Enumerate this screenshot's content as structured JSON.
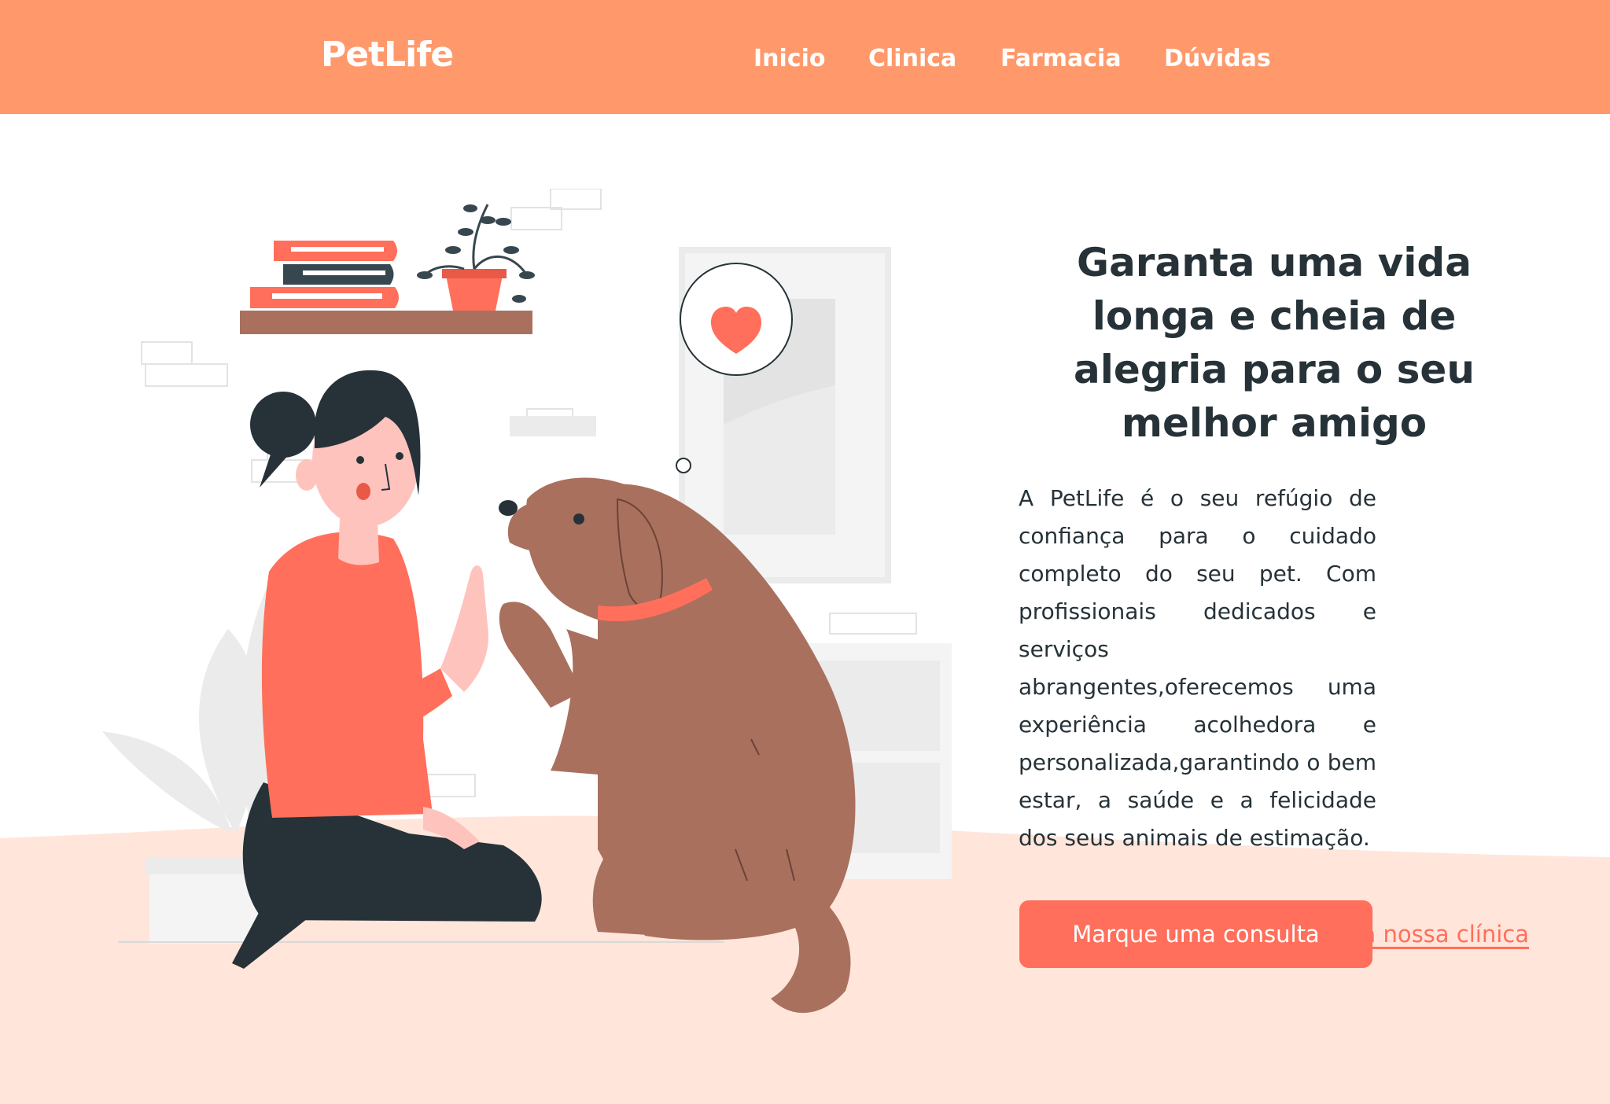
{
  "header": {
    "logo": "PetLife",
    "nav": [
      {
        "label": "Inicio"
      },
      {
        "label": "Clinica"
      },
      {
        "label": "Farmacia"
      },
      {
        "label": "Dúvidas"
      }
    ]
  },
  "hero": {
    "title": "Garanta uma vida longa e cheia de alegria para o seu melhor amigo",
    "description": "A PetLife é o seu refúgio de confiança para o cuidado completo do seu pet. Com profissionais dedicados e serviços abrangentes,oferecemos uma experiência acolhedora e personalizada,garantindo o bem estar, a saúde e a felicidade dos seus animais de estimação.",
    "cta_label": "Marque uma consulta",
    "secondary_link": "Conheça nossa clínica"
  },
  "illustration": {
    "icons": [
      "heart-icon"
    ]
  },
  "colors": {
    "header_bg": "#FF996B",
    "accent": "#FF6F5B",
    "floor": "#FFE5DA",
    "text": "#263238",
    "dog": "#A9705E"
  }
}
